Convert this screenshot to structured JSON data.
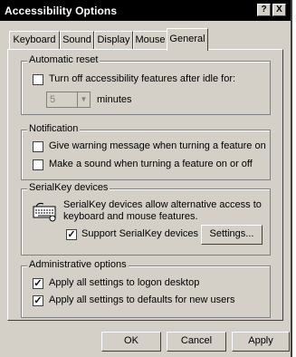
{
  "window": {
    "title": "Accessibility Options",
    "help_button": "?",
    "close_button": "X"
  },
  "tabs": [
    {
      "label": "Keyboard"
    },
    {
      "label": "Sound"
    },
    {
      "label": "Display"
    },
    {
      "label": "Mouse"
    },
    {
      "label": "General"
    }
  ],
  "active_tab": "General",
  "automatic_reset": {
    "title": "Automatic reset",
    "turn_off_label": "Turn off accessibility features after idle for:",
    "turn_off_checked": false,
    "minutes_value": "5",
    "minutes_label": "minutes"
  },
  "notification": {
    "title": "Notification",
    "warning_label": "Give warning message when turning a feature on",
    "warning_checked": false,
    "sound_label": "Make a sound when turning a feature on or off",
    "sound_checked": false
  },
  "serialkey": {
    "title": "SerialKey devices",
    "desc_line1": "SerialKey devices allow alternative access to",
    "desc_line2": "keyboard and mouse features.",
    "support_label": "Support SerialKey devices",
    "support_checked": true,
    "settings_button": "Settings..."
  },
  "admin": {
    "title": "Administrative options",
    "logon_label": "Apply all settings to logon desktop",
    "logon_checked": true,
    "defaults_label": "Apply all settings to defaults for new users",
    "defaults_checked": true
  },
  "buttons": {
    "ok": "OK",
    "cancel": "Cancel",
    "apply": "Apply"
  }
}
